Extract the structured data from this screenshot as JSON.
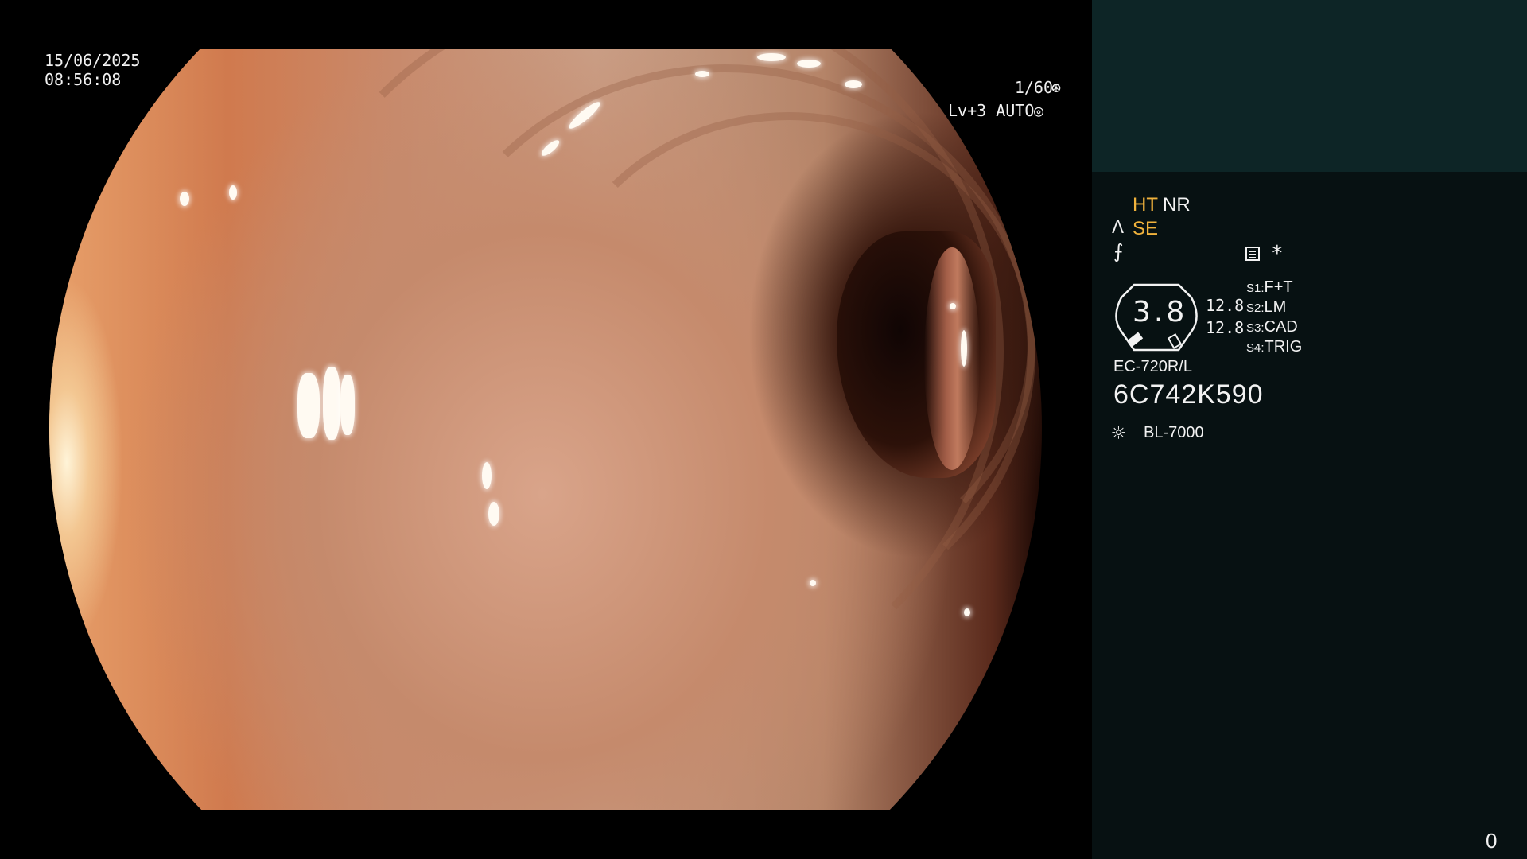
{
  "image": {
    "date": "15/06/2025",
    "time": "08:56:08",
    "shutter": "1/60",
    "shutter_icon": "⊛",
    "level": "Lv+3 AUTO",
    "auto_icon": "◎"
  },
  "panel": {
    "enhancement": {
      "label": "HT",
      "color": "#f0b23c"
    },
    "noise": {
      "label": "NR"
    },
    "structure_icon": "ᐱ",
    "structure": {
      "label": "SE",
      "color": "#f0b23c"
    },
    "function_icon": "⨍",
    "star": "*",
    "zoom": {
      "value": "3.8",
      "upper": "12.8",
      "lower": "12.8"
    },
    "switches": [
      {
        "key": "S1:",
        "value": "F+T"
      },
      {
        "key": "S2:",
        "value": "LM"
      },
      {
        "key": "S3:",
        "value": "CAD"
      },
      {
        "key": "S4:",
        "value": "TRIG"
      }
    ],
    "scope_model": "EC-720R/L",
    "scope_serial": "6C742K590",
    "light_icon": "☼",
    "light_source": "BL-7000",
    "counter": "0"
  },
  "colors": {
    "panel_top": "#0d2526",
    "panel_main": "#071112",
    "accent": "#f0b23c"
  }
}
